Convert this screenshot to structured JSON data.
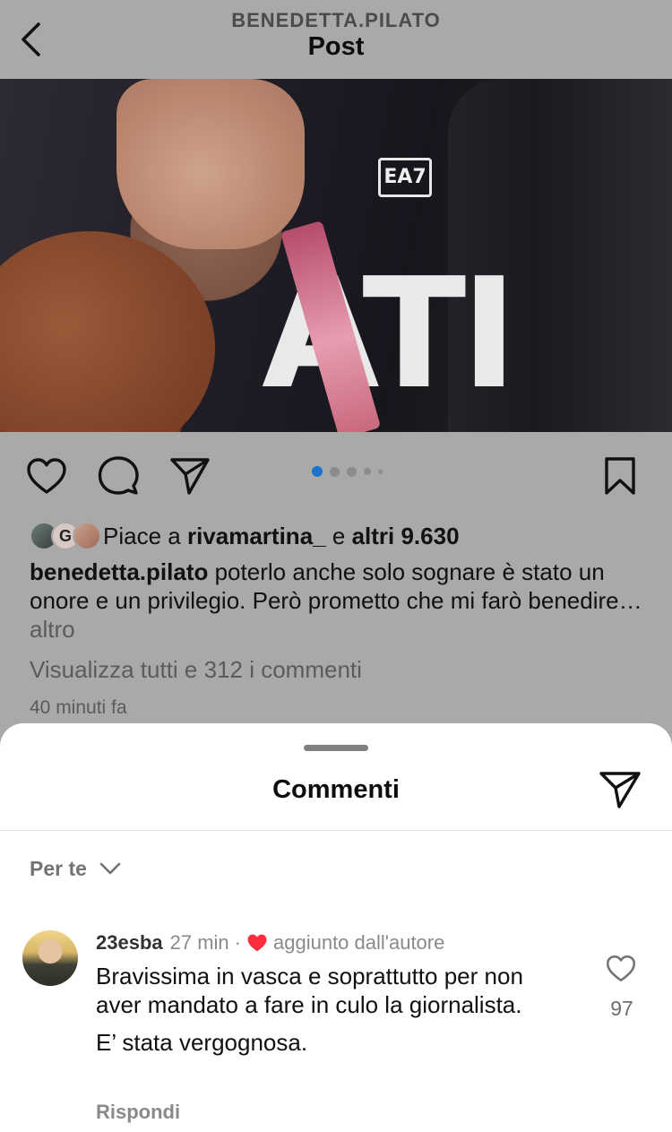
{
  "header": {
    "username": "BENEDETTA.PILATO",
    "title": "Post",
    "back_icon": "chevron-left-icon"
  },
  "post": {
    "carousel": {
      "count": 5,
      "active_index": 0
    },
    "likes": {
      "prefix": "Piace a",
      "user": "rivamartina_",
      "joiner": "e",
      "others": "altri 9.630",
      "avatar_letter": "G"
    },
    "caption": {
      "author": "benedetta.pilato",
      "text": "poterlo anche solo sognare è stato un onore e un privilegio. Però prometto che mi farò benedire…",
      "more": "altro"
    },
    "view_all_comments": "Visualizza tutti e 312 i commenti",
    "timestamp": "40 minuti fa",
    "photo_text": "ATI"
  },
  "comments_sheet": {
    "title": "Commenti",
    "sort_label": "Per te",
    "comment": {
      "username": "23esba",
      "time": "27 min",
      "separator": "·",
      "author_badge": "aggiunto dall'autore",
      "lines": [
        "Bravissima in vasca e soprattutto per non aver mandato a fare in culo la giornalista.",
        "E’ stata vergognosa."
      ],
      "reply_label": "Rispondi",
      "like_count": "97"
    }
  },
  "colors": {
    "accent_blue": "#1a73c8",
    "heart_red": "#ff2d3d",
    "dim_overlay": "#a9a9a9"
  }
}
